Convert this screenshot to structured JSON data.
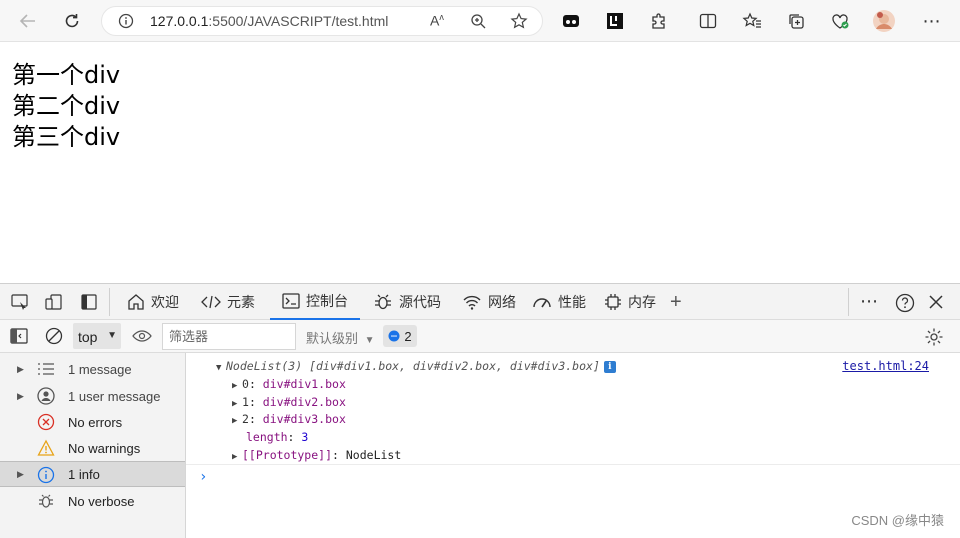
{
  "browser": {
    "url_host": "127.0.0.1",
    "url_path": ":5500/JAVASCRIPT/test.html"
  },
  "page": {
    "lines": [
      "第一个div",
      "第二个div",
      "第三个div"
    ]
  },
  "devtools": {
    "tabs": [
      "欢迎",
      "元素",
      "控制台",
      "源代码",
      "网络",
      "性能",
      "内存"
    ],
    "active_tab": "控制台",
    "context": "top",
    "filter_placeholder": "筛选器",
    "levels_label": "默认级别",
    "message_count": "2",
    "sidebar": [
      {
        "label": "1 message",
        "icon": "list-icon"
      },
      {
        "label": "1 user message",
        "icon": "user-icon"
      },
      {
        "label": "No errors",
        "icon": "error-icon"
      },
      {
        "label": "No warnings",
        "icon": "warning-icon"
      },
      {
        "label": "1 info",
        "icon": "info-icon",
        "selected": true
      },
      {
        "label": "No verbose",
        "icon": "bug-icon"
      }
    ],
    "console": {
      "header": "NodeList(3) [div#div1.box, div#div2.box, div#div3.box]",
      "source_link": "test.html:24",
      "entries": [
        {
          "key": "0",
          "value": "div#div1.box"
        },
        {
          "key": "1",
          "value": "div#div2.box"
        },
        {
          "key": "2",
          "value": "div#div3.box"
        }
      ],
      "length_key": "length",
      "length_value": "3",
      "proto_key": "[[Prototype]]",
      "proto_value": "NodeList"
    }
  },
  "watermark": "CSDN @缘中猿"
}
